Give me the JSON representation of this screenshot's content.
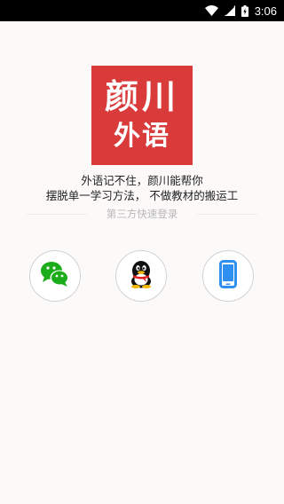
{
  "status_bar": {
    "time": "3:06"
  },
  "logo": {
    "line1": "颜川",
    "line2": "外语",
    "bg_color": "#d93a3a"
  },
  "slogan": {
    "line1": "外语记不住，颜川能帮你",
    "line2": "摆脱单一学习方法， 不做教材的搬运工"
  },
  "login": {
    "section_label": "第三方快速登录",
    "options": [
      {
        "name": "wechat",
        "icon": "wechat-icon",
        "color": "#1aad19"
      },
      {
        "name": "qq",
        "icon": "qq-penguin-icon",
        "color": "#000000"
      },
      {
        "name": "phone",
        "icon": "phone-icon",
        "color": "#2f8ff0"
      }
    ]
  }
}
